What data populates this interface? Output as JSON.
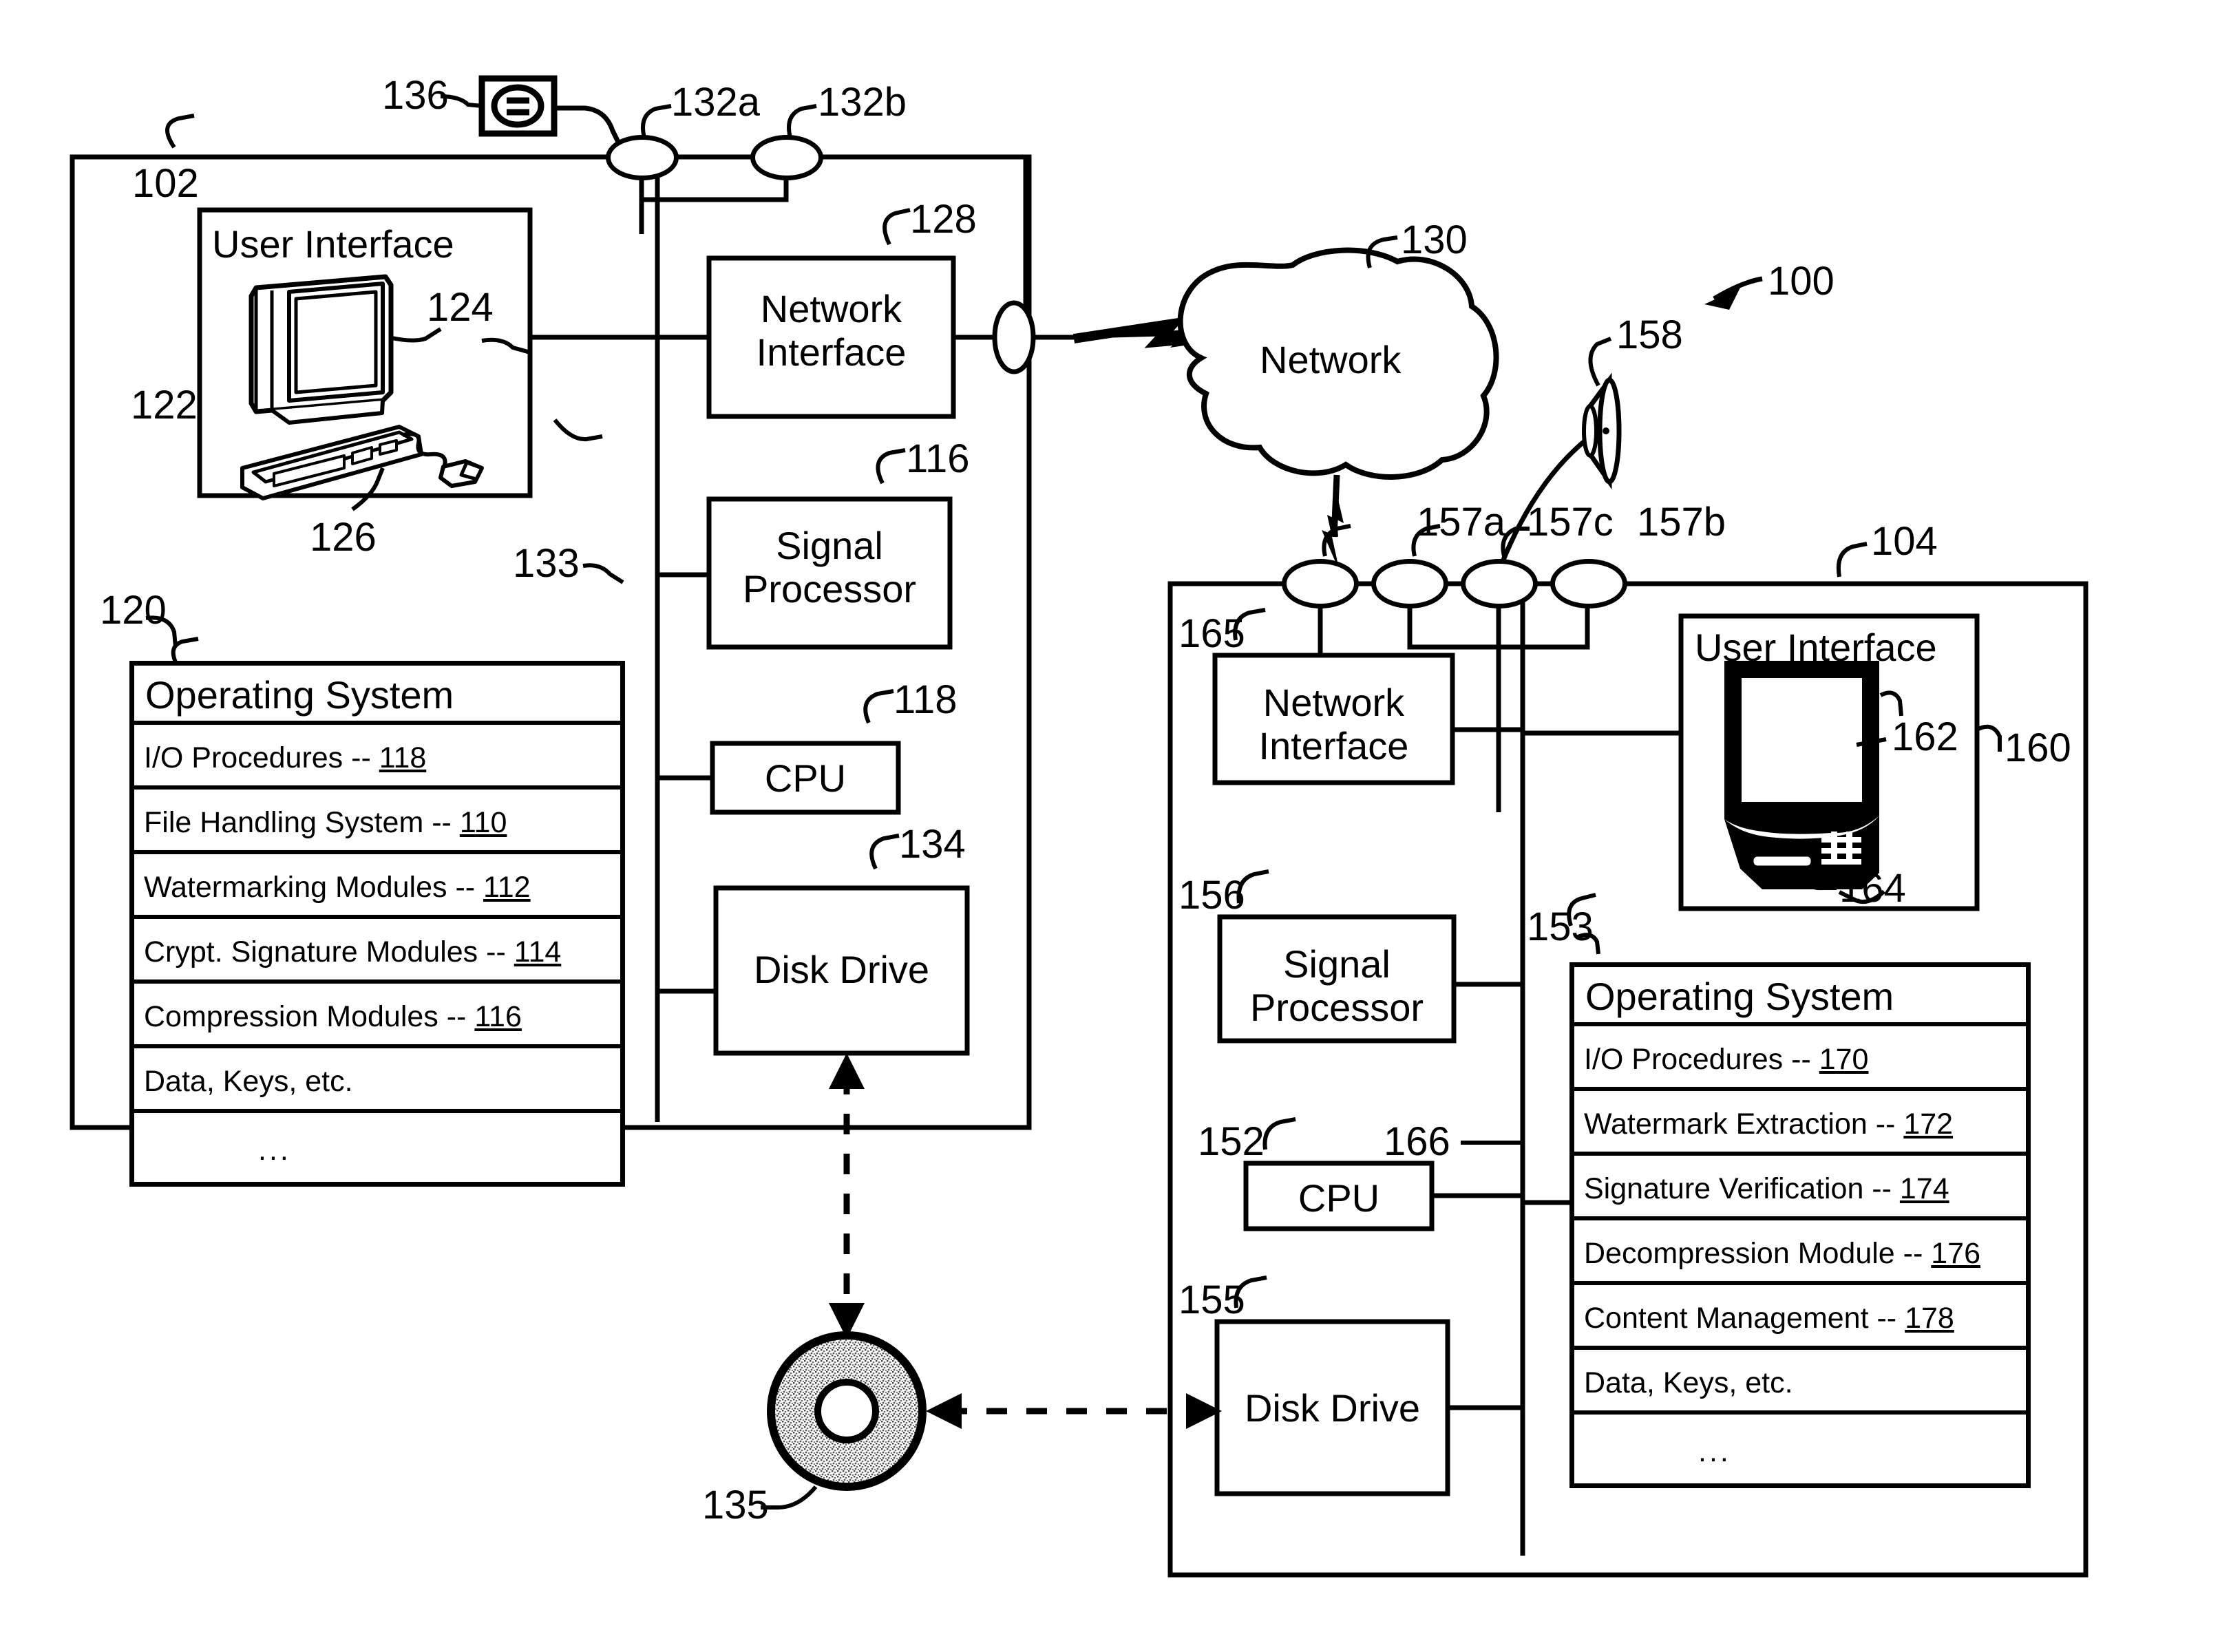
{
  "figure": {
    "system_ref": "100",
    "first_device_ref": "102",
    "second_device_ref": "104"
  },
  "left_device": {
    "container_ref": "102",
    "user_interface": {
      "title": "User Interface",
      "panel_ref": "122",
      "monitor_ref": "124",
      "keyboard_ref": "126"
    },
    "bus_ref": "133",
    "components": [
      {
        "label_line1": "Network",
        "label_line2": "Interface",
        "ref": "128"
      },
      {
        "label_line1": "Signal",
        "label_line2": "Processor",
        "ref": "116"
      },
      {
        "label_line1": "CPU",
        "label_line2": "",
        "ref": "118"
      },
      {
        "label_line1": "Disk Drive",
        "label_line2": "",
        "ref": "134"
      }
    ],
    "antennas": [
      {
        "ref": "132a"
      },
      {
        "ref": "132b"
      }
    ],
    "peripheral": {
      "ref": "136",
      "icon": "media-device-icon"
    },
    "operating_system": {
      "table_ref": "120",
      "title": "Operating System",
      "rows": [
        {
          "label": "I/O Procedures -- ",
          "num": "118"
        },
        {
          "label": "File Handling System -- ",
          "num": "110"
        },
        {
          "label": "Watermarking Modules -- ",
          "num": "112"
        },
        {
          "label": "Crypt. Signature Modules -- ",
          "num": "114"
        },
        {
          "label": "Compression Modules -- ",
          "num": "116"
        },
        {
          "label": "Data, Keys, etc.",
          "num": ""
        },
        {
          "label": "...",
          "num": ""
        }
      ]
    }
  },
  "network": {
    "label": "Network",
    "ref": "130"
  },
  "removable_media": {
    "ref": "135"
  },
  "right_device": {
    "container_ref": "104",
    "user_interface": {
      "title": "User Interface",
      "panel_ref": "160",
      "screen_ref": "162",
      "button_ref": "164"
    },
    "bus_ref": "166",
    "components": [
      {
        "label_line1": "Network",
        "label_line2": "Interface",
        "ref": "165"
      },
      {
        "label_line1": "Signal",
        "label_line2": "Processor",
        "ref": "156"
      },
      {
        "label_line1": "CPU",
        "label_line2": "",
        "ref": "152"
      },
      {
        "label_line1": "Disk Drive",
        "label_line2": "",
        "ref": "155"
      }
    ],
    "antennas": [
      {
        "ref": "157a"
      },
      {
        "ref": "157c"
      },
      {
        "ref": "157b"
      }
    ],
    "peripheral": {
      "ref": "158",
      "icon": "speaker-icon"
    },
    "operating_system": {
      "table_ref": "153",
      "title": "Operating System",
      "rows": [
        {
          "label": "I/O Procedures -- ",
          "num": "170"
        },
        {
          "label": "Watermark Extraction -- ",
          "num": "172"
        },
        {
          "label": "Signature Verification -- ",
          "num": "174"
        },
        {
          "label": "Decompression Module -- ",
          "num": "176"
        },
        {
          "label": "Content Management -- ",
          "num": "178"
        },
        {
          "label": "Data, Keys, etc.",
          "num": ""
        },
        {
          "label": "...",
          "num": ""
        }
      ]
    }
  }
}
